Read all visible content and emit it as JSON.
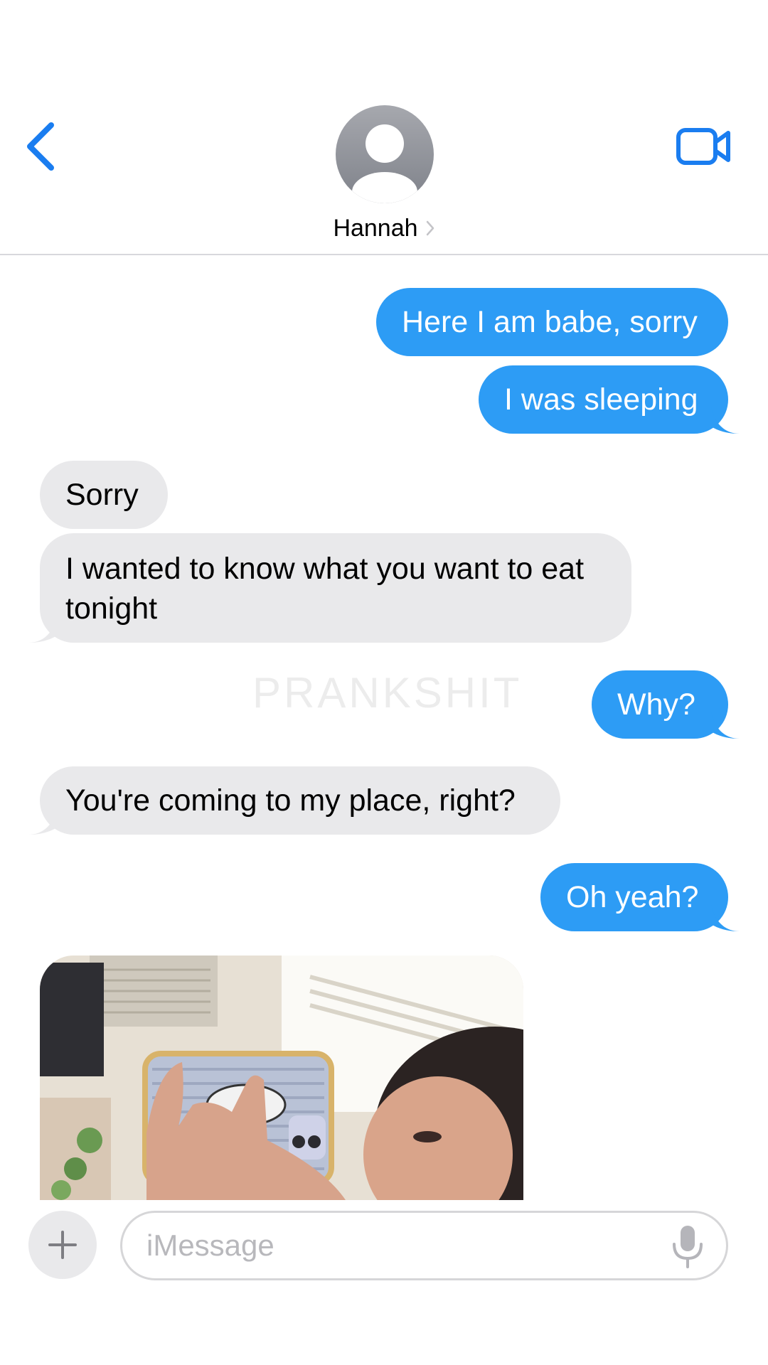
{
  "header": {
    "contact_name": "Hannah",
    "back_icon": "chevron-left-icon",
    "video_icon": "video-camera-icon",
    "avatar_icon": "person-placeholder-icon",
    "disclosure_icon": "chevron-right-icon",
    "accent_color": "#1a7df0"
  },
  "messages": [
    {
      "direction": "sent",
      "text": "Here I am babe, sorry"
    },
    {
      "direction": "sent",
      "text": "I was sleeping"
    },
    {
      "direction": "received",
      "text": "Sorry"
    },
    {
      "direction": "received",
      "text": "I wanted to know what you want to eat tonight"
    },
    {
      "direction": "sent",
      "text": "Why?"
    },
    {
      "direction": "received",
      "text": "You're coming to my place, right?"
    },
    {
      "direction": "sent",
      "text": "Oh yeah?"
    },
    {
      "direction": "received",
      "type": "image"
    }
  ],
  "watermark": "PRANKSHIT",
  "compose": {
    "placeholder": "iMessage",
    "plus_icon": "plus-icon",
    "mic_icon": "microphone-icon"
  },
  "colors": {
    "sent_bubble": "#2d9cf5",
    "received_bubble": "#e9e9eb"
  }
}
